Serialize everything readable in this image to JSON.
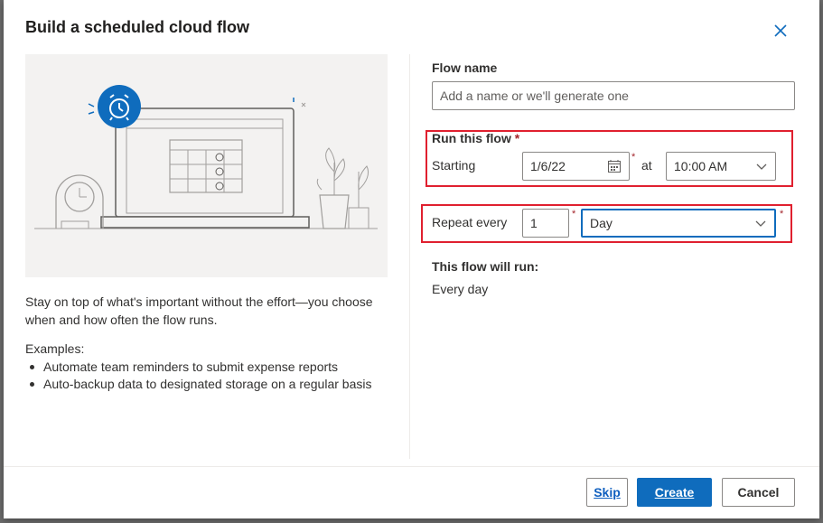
{
  "dialog": {
    "title": "Build a scheduled cloud flow",
    "close_icon": "close-icon"
  },
  "left": {
    "description": "Stay on top of what's important without the effort—you choose when and how often the flow runs.",
    "examples_label": "Examples:",
    "examples": [
      "Automate team reminders to submit expense reports",
      "Auto-backup data to designated storage on a regular basis"
    ]
  },
  "form": {
    "flow_name_label": "Flow name",
    "flow_name_placeholder": "Add a name or we'll generate one",
    "run_this_flow_label": "Run this flow",
    "required_mark": "*",
    "starting_label": "Starting",
    "start_date": "1/6/22",
    "at_label": "at",
    "start_time": "10:00 AM",
    "repeat_every_label": "Repeat every",
    "repeat_interval": "1",
    "repeat_unit": "Day",
    "summary_label": "This flow will run:",
    "summary_value": "Every day"
  },
  "footer": {
    "skip_label": "Skip",
    "create_label": "Create",
    "cancel_label": "Cancel"
  },
  "colors": {
    "accent": "#0f6cbd",
    "highlight_box": "#e0202f",
    "illustration_bg": "#f3f2f1"
  }
}
